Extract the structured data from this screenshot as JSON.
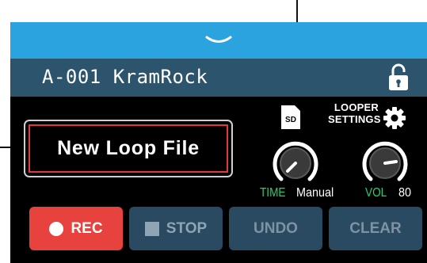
{
  "patch": {
    "name": "A-001 KramRock"
  },
  "icons": {
    "storage": "sd-card-icon",
    "lock": "lock-icon",
    "settings": "gear-icon",
    "expand": "chevron-down-icon"
  },
  "storage": {
    "label": "SD"
  },
  "looper_settings": {
    "line1": "LOOPER",
    "line2": "SETTINGS"
  },
  "file": {
    "label": "New Loop File"
  },
  "time": {
    "name": "TIME",
    "value": "Manual"
  },
  "vol": {
    "name": "VOL",
    "value": "80",
    "level": 0.8
  },
  "buttons": {
    "rec": "REC",
    "stop": "STOP",
    "undo": "UNDO",
    "clear": "CLEAR"
  },
  "colors": {
    "accent_blue": "#2aa3df",
    "title_bar": "#2c546c",
    "rec_red": "#e8423f",
    "param_green": "#22d26b",
    "button_inactive": "#294a60",
    "highlight_border": "#e23a3a"
  }
}
